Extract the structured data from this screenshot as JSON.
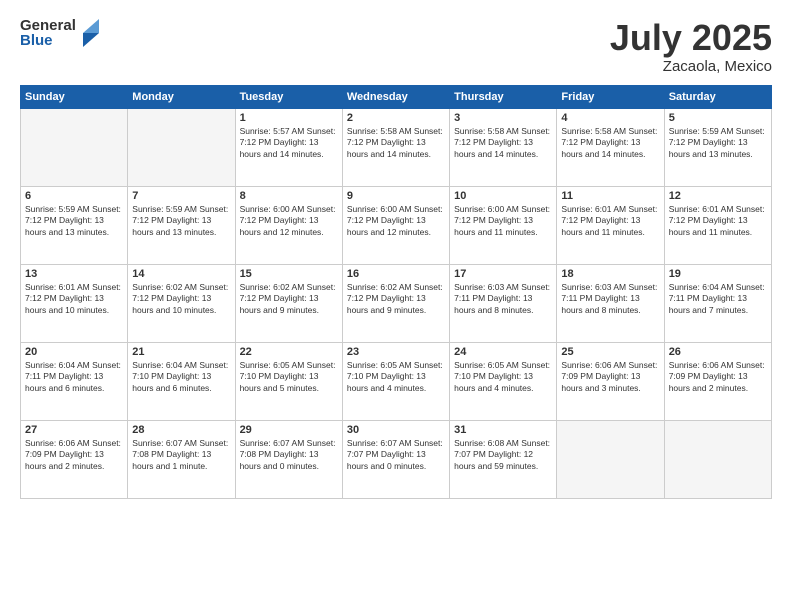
{
  "header": {
    "logo_general": "General",
    "logo_blue": "Blue",
    "title": "July 2025",
    "subtitle": "Zacaola, Mexico"
  },
  "days_of_week": [
    "Sunday",
    "Monday",
    "Tuesday",
    "Wednesday",
    "Thursday",
    "Friday",
    "Saturday"
  ],
  "weeks": [
    [
      {
        "day": "",
        "info": ""
      },
      {
        "day": "",
        "info": ""
      },
      {
        "day": "1",
        "info": "Sunrise: 5:57 AM\nSunset: 7:12 PM\nDaylight: 13 hours\nand 14 minutes."
      },
      {
        "day": "2",
        "info": "Sunrise: 5:58 AM\nSunset: 7:12 PM\nDaylight: 13 hours\nand 14 minutes."
      },
      {
        "day": "3",
        "info": "Sunrise: 5:58 AM\nSunset: 7:12 PM\nDaylight: 13 hours\nand 14 minutes."
      },
      {
        "day": "4",
        "info": "Sunrise: 5:58 AM\nSunset: 7:12 PM\nDaylight: 13 hours\nand 14 minutes."
      },
      {
        "day": "5",
        "info": "Sunrise: 5:59 AM\nSunset: 7:12 PM\nDaylight: 13 hours\nand 13 minutes."
      }
    ],
    [
      {
        "day": "6",
        "info": "Sunrise: 5:59 AM\nSunset: 7:12 PM\nDaylight: 13 hours\nand 13 minutes."
      },
      {
        "day": "7",
        "info": "Sunrise: 5:59 AM\nSunset: 7:12 PM\nDaylight: 13 hours\nand 13 minutes."
      },
      {
        "day": "8",
        "info": "Sunrise: 6:00 AM\nSunset: 7:12 PM\nDaylight: 13 hours\nand 12 minutes."
      },
      {
        "day": "9",
        "info": "Sunrise: 6:00 AM\nSunset: 7:12 PM\nDaylight: 13 hours\nand 12 minutes."
      },
      {
        "day": "10",
        "info": "Sunrise: 6:00 AM\nSunset: 7:12 PM\nDaylight: 13 hours\nand 11 minutes."
      },
      {
        "day": "11",
        "info": "Sunrise: 6:01 AM\nSunset: 7:12 PM\nDaylight: 13 hours\nand 11 minutes."
      },
      {
        "day": "12",
        "info": "Sunrise: 6:01 AM\nSunset: 7:12 PM\nDaylight: 13 hours\nand 11 minutes."
      }
    ],
    [
      {
        "day": "13",
        "info": "Sunrise: 6:01 AM\nSunset: 7:12 PM\nDaylight: 13 hours\nand 10 minutes."
      },
      {
        "day": "14",
        "info": "Sunrise: 6:02 AM\nSunset: 7:12 PM\nDaylight: 13 hours\nand 10 minutes."
      },
      {
        "day": "15",
        "info": "Sunrise: 6:02 AM\nSunset: 7:12 PM\nDaylight: 13 hours\nand 9 minutes."
      },
      {
        "day": "16",
        "info": "Sunrise: 6:02 AM\nSunset: 7:12 PM\nDaylight: 13 hours\nand 9 minutes."
      },
      {
        "day": "17",
        "info": "Sunrise: 6:03 AM\nSunset: 7:11 PM\nDaylight: 13 hours\nand 8 minutes."
      },
      {
        "day": "18",
        "info": "Sunrise: 6:03 AM\nSunset: 7:11 PM\nDaylight: 13 hours\nand 8 minutes."
      },
      {
        "day": "19",
        "info": "Sunrise: 6:04 AM\nSunset: 7:11 PM\nDaylight: 13 hours\nand 7 minutes."
      }
    ],
    [
      {
        "day": "20",
        "info": "Sunrise: 6:04 AM\nSunset: 7:11 PM\nDaylight: 13 hours\nand 6 minutes."
      },
      {
        "day": "21",
        "info": "Sunrise: 6:04 AM\nSunset: 7:10 PM\nDaylight: 13 hours\nand 6 minutes."
      },
      {
        "day": "22",
        "info": "Sunrise: 6:05 AM\nSunset: 7:10 PM\nDaylight: 13 hours\nand 5 minutes."
      },
      {
        "day": "23",
        "info": "Sunrise: 6:05 AM\nSunset: 7:10 PM\nDaylight: 13 hours\nand 4 minutes."
      },
      {
        "day": "24",
        "info": "Sunrise: 6:05 AM\nSunset: 7:10 PM\nDaylight: 13 hours\nand 4 minutes."
      },
      {
        "day": "25",
        "info": "Sunrise: 6:06 AM\nSunset: 7:09 PM\nDaylight: 13 hours\nand 3 minutes."
      },
      {
        "day": "26",
        "info": "Sunrise: 6:06 AM\nSunset: 7:09 PM\nDaylight: 13 hours\nand 2 minutes."
      }
    ],
    [
      {
        "day": "27",
        "info": "Sunrise: 6:06 AM\nSunset: 7:09 PM\nDaylight: 13 hours\nand 2 minutes."
      },
      {
        "day": "28",
        "info": "Sunrise: 6:07 AM\nSunset: 7:08 PM\nDaylight: 13 hours\nand 1 minute."
      },
      {
        "day": "29",
        "info": "Sunrise: 6:07 AM\nSunset: 7:08 PM\nDaylight: 13 hours\nand 0 minutes."
      },
      {
        "day": "30",
        "info": "Sunrise: 6:07 AM\nSunset: 7:07 PM\nDaylight: 13 hours\nand 0 minutes."
      },
      {
        "day": "31",
        "info": "Sunrise: 6:08 AM\nSunset: 7:07 PM\nDaylight: 12 hours\nand 59 minutes."
      },
      {
        "day": "",
        "info": ""
      },
      {
        "day": "",
        "info": ""
      }
    ]
  ]
}
